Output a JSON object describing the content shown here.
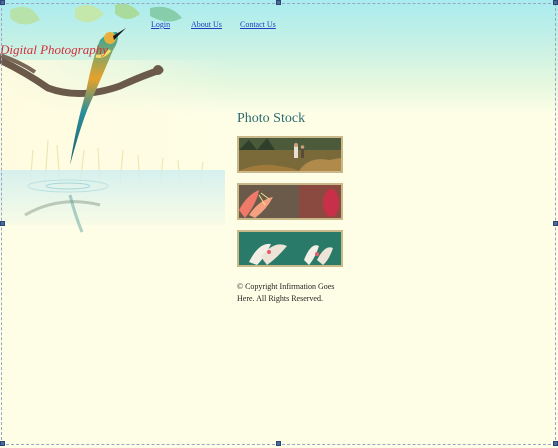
{
  "nav": {
    "items": [
      {
        "label": "Login"
      },
      {
        "label": "About Us"
      },
      {
        "label": "Contact Us"
      }
    ]
  },
  "brand": {
    "title": "Digital Photography"
  },
  "content": {
    "section_title": "Photo Stock",
    "photos": [
      {
        "icon": "hikers-photo"
      },
      {
        "icon": "lily-photo"
      },
      {
        "icon": "white-flowers-photo"
      }
    ],
    "copyright": "© Copyright Infirmation Goes Here. All Rights Reserved."
  },
  "colors": {
    "top_gradient": "#a9ecef",
    "page_background": "#fefee6",
    "brand_text": "#d0303a",
    "link": "#1a3fbf",
    "heading": "#2a6a70",
    "thumb_border": "#c9b88a",
    "selection_frame": "#9aa7c4"
  }
}
